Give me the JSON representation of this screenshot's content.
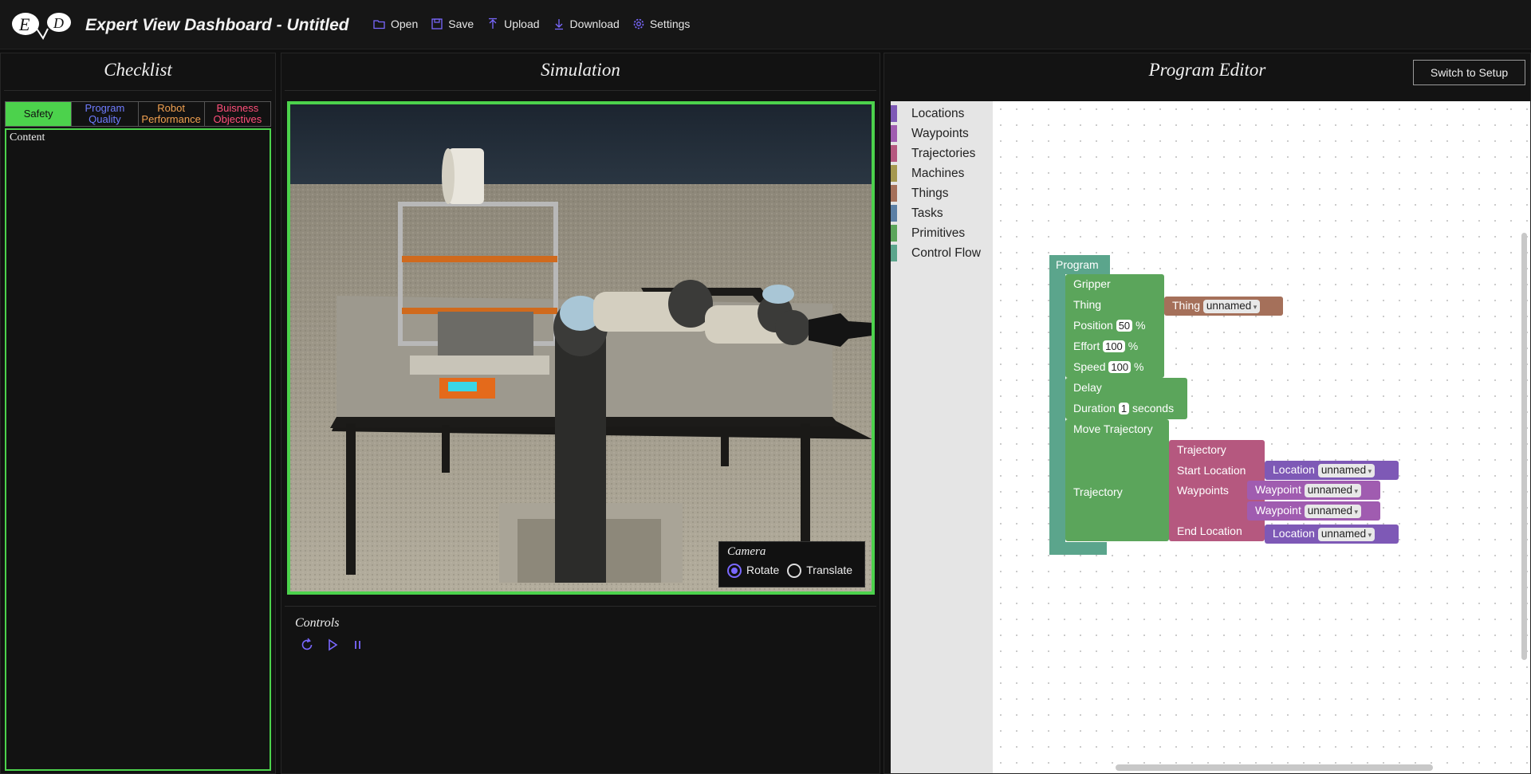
{
  "app": {
    "title": "Expert View Dashboard - Untitled"
  },
  "menu": [
    {
      "label": "Open",
      "icon": "folder-open-icon"
    },
    {
      "label": "Save",
      "icon": "save-icon"
    },
    {
      "label": "Upload",
      "icon": "upload-icon"
    },
    {
      "label": "Download",
      "icon": "download-icon"
    },
    {
      "label": "Settings",
      "icon": "gear-icon"
    }
  ],
  "checklist": {
    "title": "Checklist",
    "tabs": [
      {
        "label": "Safety",
        "color": "#4cd24c",
        "active": true
      },
      {
        "label": "Program Quality",
        "color": "#6f7cff"
      },
      {
        "label": "Robot Performance",
        "color": "#f0a050"
      },
      {
        "label": "Buisness Objectives",
        "color": "#ff4f7a"
      }
    ],
    "content": "Content"
  },
  "simulation": {
    "title": "Simulation",
    "camera": {
      "title": "Camera",
      "options": [
        "Rotate",
        "Translate"
      ],
      "selected": "Rotate"
    },
    "controls": {
      "title": "Controls",
      "buttons": [
        "reset-icon",
        "play-icon",
        "pause-icon"
      ]
    }
  },
  "editor": {
    "title": "Program Editor",
    "switch_label": "Switch to Setup",
    "toolbox": [
      {
        "label": "Locations",
        "color": "#7e59b6"
      },
      {
        "label": "Waypoints",
        "color": "#a05cb0"
      },
      {
        "label": "Trajectories",
        "color": "#b5587f"
      },
      {
        "label": "Machines",
        "color": "#a5984f"
      },
      {
        "label": "Things",
        "color": "#a5705a"
      },
      {
        "label": "Tasks",
        "color": "#5b7fa5"
      },
      {
        "label": "Primitives",
        "color": "#5ba55b"
      },
      {
        "label": "Control Flow",
        "color": "#5ba58c"
      }
    ],
    "blocks": {
      "program": "Program",
      "gripper": "Gripper",
      "thing": "Thing",
      "thing_block": "Thing",
      "thing_value": "unnamed",
      "position": "Position",
      "position_value": "50",
      "effort": "Effort",
      "effort_value": "100",
      "speed": "Speed",
      "speed_value": "100",
      "percent": "%",
      "delay": "Delay",
      "duration": "Duration",
      "duration_value": "1",
      "seconds": "seconds",
      "move_trajectory": "Move Trajectory",
      "trajectory": "Trajectory",
      "trajectory_block": "Trajectory",
      "start_location": "Start Location",
      "waypoints": "Waypoints",
      "end_location": "End Location",
      "location": "Location",
      "waypoint": "Waypoint",
      "unnamed": "unnamed"
    }
  },
  "colors": {
    "accent": "#4cd24c",
    "primitive_block": "#5ba55b",
    "control_block": "#5ba58c",
    "trajectory_block": "#b5587f",
    "location_block": "#7e59b6",
    "waypoint_block": "#a05cb0",
    "thing_block": "#a5705a",
    "icon_purple": "#7a68ff"
  }
}
